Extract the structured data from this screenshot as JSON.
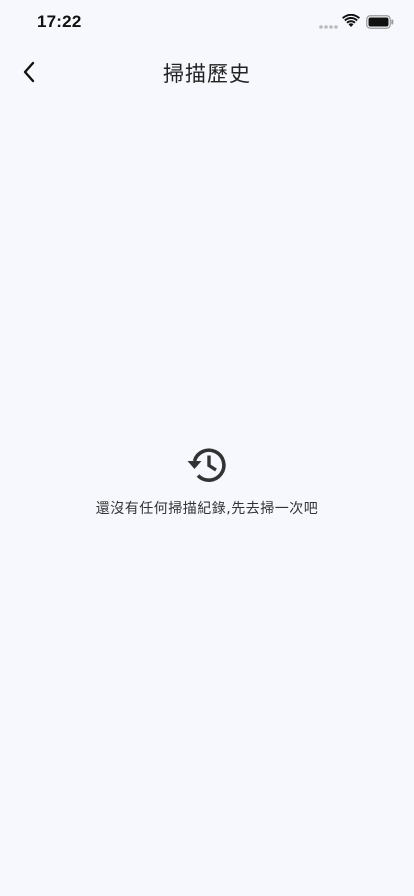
{
  "status_bar": {
    "time": "17:22"
  },
  "header": {
    "title": "掃描歷史"
  },
  "empty_state": {
    "message": "還沒有任何掃描紀錄,先去掃一次吧",
    "icon": "history-icon"
  }
}
